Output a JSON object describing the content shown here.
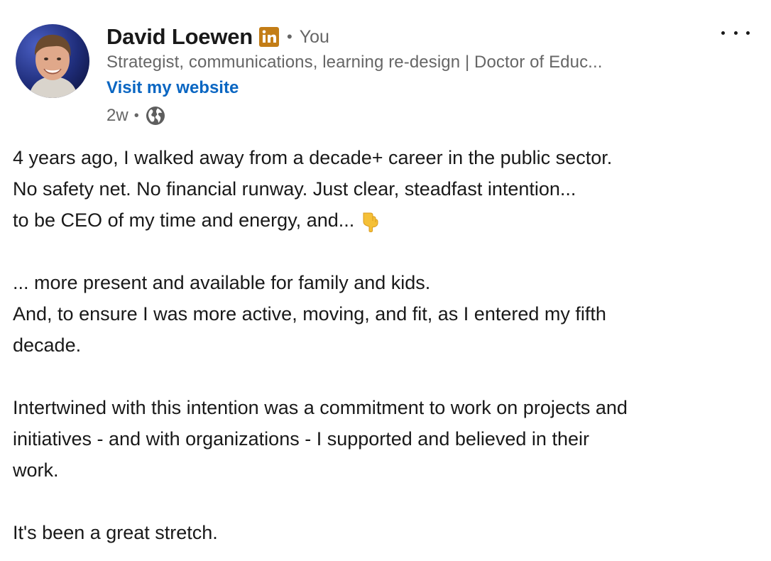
{
  "author": {
    "name": "David Loewen",
    "badge_icon": "linkedin-premium-icon",
    "badge_color": "#c37d16",
    "separator": "•",
    "relation": "You",
    "headline": "Strategist, communications, learning re-design | Doctor of Educ...",
    "website_link": "Visit my website",
    "link_color": "#0a66c2"
  },
  "meta": {
    "time_ago": "2w",
    "separator": "•",
    "visibility_icon": "globe-icon"
  },
  "menu_icon": "more-horizontal-icon",
  "post": {
    "paragraphs": [
      {
        "lines": [
          "4 years ago, I walked away from a decade+ career in the public sector.",
          "No safety net. No financial runway. Just clear, steadfast intention...",
          "to be CEO of my time and energy, and..."
        ],
        "emoji": "point-down-emoji"
      },
      {
        "lines": [
          "... more present and available for family and kids.",
          "And, to ensure I was more active, moving, and fit, as I entered my fifth",
          "decade."
        ]
      },
      {
        "lines": [
          "Intertwined with this intention was a commitment to work on projects and",
          "initiatives - and with organizations - I supported and believed in their",
          "work."
        ]
      },
      {
        "lines": [
          "It's been a great stretch."
        ]
      }
    ]
  }
}
